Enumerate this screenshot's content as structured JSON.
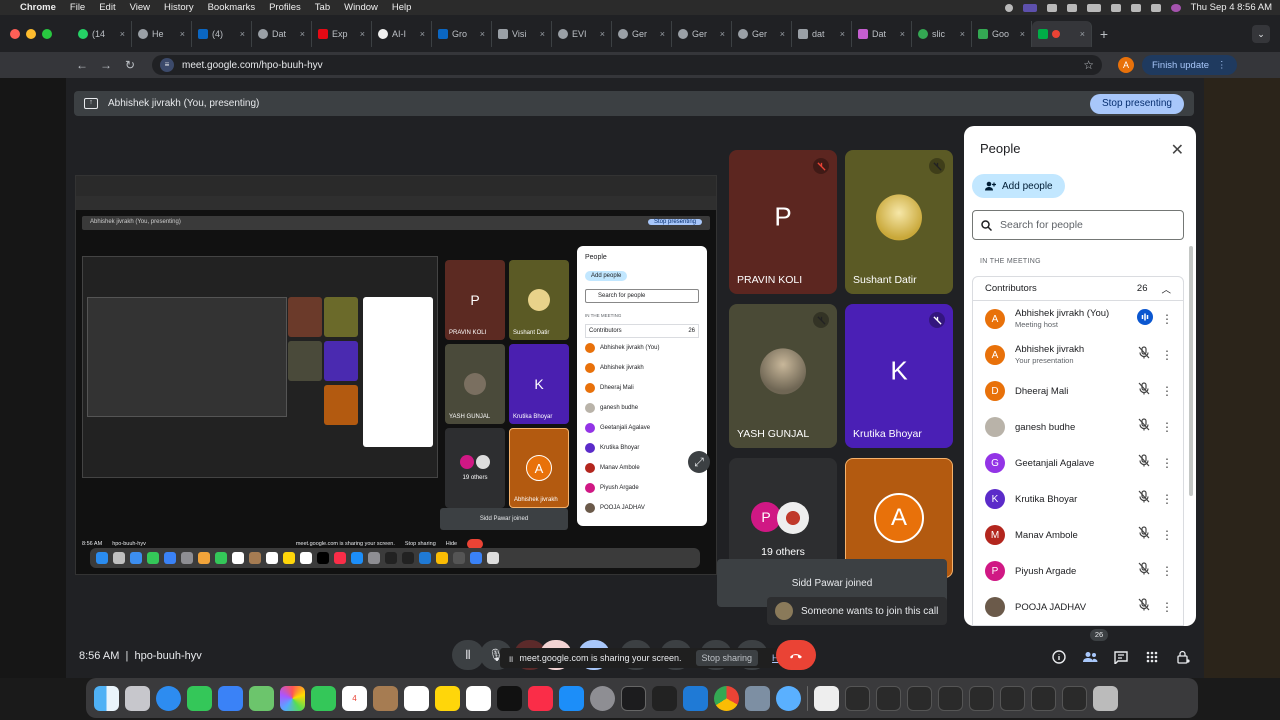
{
  "menubar": {
    "app": "Chrome",
    "items": [
      "File",
      "Edit",
      "View",
      "History",
      "Bookmarks",
      "Profiles",
      "Tab",
      "Window",
      "Help"
    ],
    "clock": "Thu Sep 4  8:56 AM"
  },
  "tabs": [
    "(14",
    "He",
    "(4)",
    "Dat",
    "Exp",
    "AI-I",
    "Gro",
    "Visi",
    "EVI",
    "Ger",
    "Ger",
    "Ger",
    "dat",
    "Dat",
    "slic",
    "Goo",
    ""
  ],
  "address": {
    "url": "meet.google.com/hpo-buuh-hyv",
    "finish_update": "Finish update",
    "profile_initial": "A"
  },
  "presenting": {
    "label": "Abhishek jivrakh (You, presenting)",
    "stop": "Stop presenting"
  },
  "shared_screen": {
    "presenting_label": "Abhishek jivrakh (You, presenting)",
    "stop": "Stop presenting",
    "tiles": [
      "PRAVIN KOLI",
      "Sushant Datir",
      "YASH GUNJAL",
      "Krutika Bhoyar",
      "19 others",
      "Abhishek jivrakh"
    ],
    "people_title": "People",
    "add_people": "Add people",
    "search": "Search for people",
    "in_meeting": "IN THE MEETING",
    "contributors": "Contributors",
    "count": "26",
    "rows": [
      "Abhishek jivrakh (You)",
      "Abhishek jivrakh",
      "Dheeraj Mali",
      "ganesh budhe",
      "Geetanjali Agalave",
      "Krutika Bhoyar",
      "Manav Ambole",
      "Piyush Argade",
      "POOJA JADHAV"
    ],
    "toast": "Sidd Pawar joined",
    "clock": "8:56 AM",
    "meeting_code": "hpo-buuh-hyv",
    "share_notice": "meet.google.com is sharing your screen.",
    "share_stop": "Stop sharing",
    "share_hide": "Hide"
  },
  "tiles": {
    "pravin": {
      "initial": "P",
      "name": "PRAVIN KOLI"
    },
    "sushant": {
      "name": "Sushant Datir"
    },
    "yash": {
      "name": "YASH GUNJAL"
    },
    "krutika": {
      "initial": "K",
      "name": "Krutika Bhoyar"
    },
    "others": {
      "initial": "P",
      "label": "19 others"
    },
    "self": {
      "initial": "A"
    }
  },
  "notifications": {
    "joined": "Sidd Pawar joined",
    "knock": "Someone wants to join this call"
  },
  "people_panel": {
    "title": "People",
    "add_people": "Add people",
    "search_placeholder": "Search for people",
    "section": "IN THE MEETING",
    "group": "Contributors",
    "count": "26",
    "rows": [
      {
        "initial": "A",
        "name": "Abhishek jivrakh (You)",
        "sub": "Meeting host",
        "color": "#e8710a"
      },
      {
        "initial": "A",
        "name": "Abhishek jivrakh",
        "sub": "Your presentation",
        "color": "#e8710a"
      },
      {
        "initial": "D",
        "name": "Dheeraj Mali",
        "sub": "",
        "color": "#e8710a"
      },
      {
        "initial": "",
        "name": "ganesh budhe",
        "sub": "",
        "color": "#b9b3a9"
      },
      {
        "initial": "G",
        "name": "Geetanjali Agalave",
        "sub": "",
        "color": "#9334e6"
      },
      {
        "initial": "K",
        "name": "Krutika Bhoyar",
        "sub": "",
        "color": "#5b2bc9"
      },
      {
        "initial": "M",
        "name": "Manav Ambole",
        "sub": "",
        "color": "#b3261e"
      },
      {
        "initial": "P",
        "name": "Piyush Argade",
        "sub": "",
        "color": "#d01884"
      },
      {
        "initial": "",
        "name": "POOJA JADHAV",
        "sub": "",
        "color": "#6b5a4a"
      }
    ]
  },
  "bottom_bar": {
    "clock": "8:56 AM",
    "meeting_code": "hpo-buuh-hyv",
    "share_notice": "meet.google.com is sharing your screen.",
    "stop_sharing": "Stop sharing",
    "hide": "Hide",
    "people_badge": "26"
  },
  "icons": [
    "mic-icon",
    "end-call-icon",
    "info-icon",
    "people-icon",
    "chat-icon",
    "activities-icon",
    "host-controls-icon",
    "expand-icon",
    "close-icon",
    "search-icon",
    "add-person-icon",
    "mic-off-icon",
    "more-vert-icon",
    "chevron-up-icon"
  ],
  "colors": {
    "accent": "#a8c7fa",
    "end_call": "#ea4335",
    "chip": "#c2e7ff",
    "orange_avatar": "#e8710a"
  }
}
